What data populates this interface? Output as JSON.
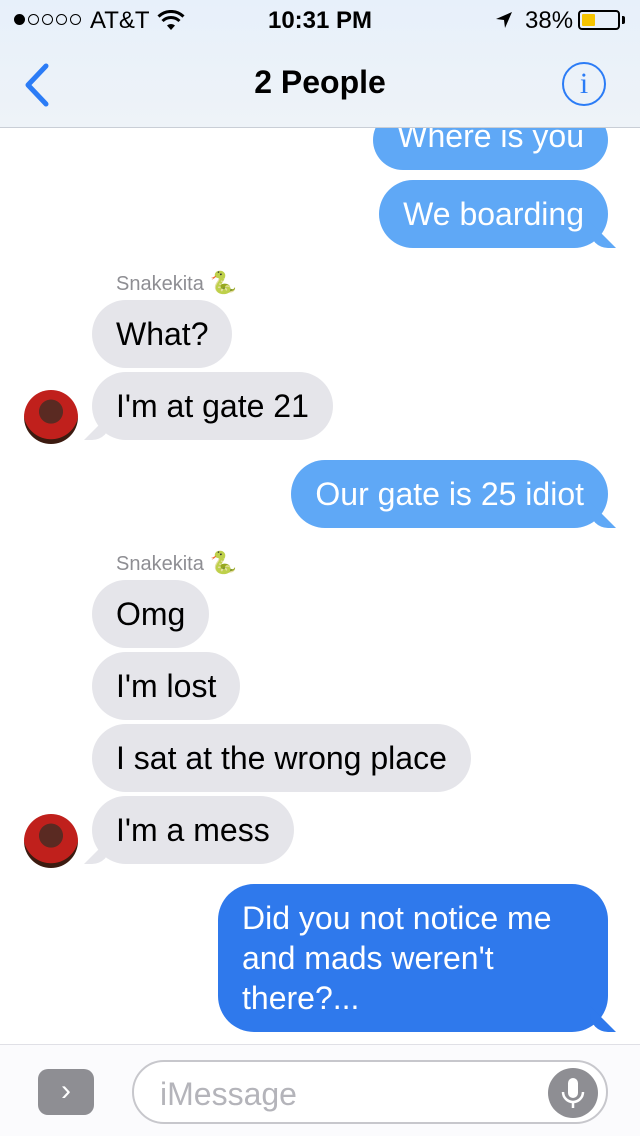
{
  "status_bar": {
    "carrier": "AT&T",
    "time": "10:31 PM",
    "battery_percent": "38%",
    "battery_level": 0.38,
    "signal_bars": 1
  },
  "nav": {
    "title": "2 People",
    "back_icon": "chevron-left-icon",
    "info_icon": "info-icon",
    "info_glyph": "i"
  },
  "messages": {
    "m1": "Where is you",
    "m2": "We boarding",
    "sender1": "Snakekita",
    "m3": "What?",
    "m4": "I'm at gate 21",
    "m5": "Our gate is 25 idiot",
    "sender2": "Snakekita",
    "m6": "Omg",
    "m7": "I'm lost",
    "m8": "I sat at the wrong place",
    "m9": "I'm a mess",
    "m10": "Did you not notice me and mads weren't there?..."
  },
  "sender_emoji": "🐍",
  "input": {
    "placeholder": "iMessage",
    "apps_glyph": "›",
    "mic_icon": "microphone-icon"
  },
  "colors": {
    "outgoing": "#5fa8f6",
    "outgoing_latest": "#2f79ec",
    "incoming": "#e5e5ea",
    "accent": "#2b7cf6"
  }
}
